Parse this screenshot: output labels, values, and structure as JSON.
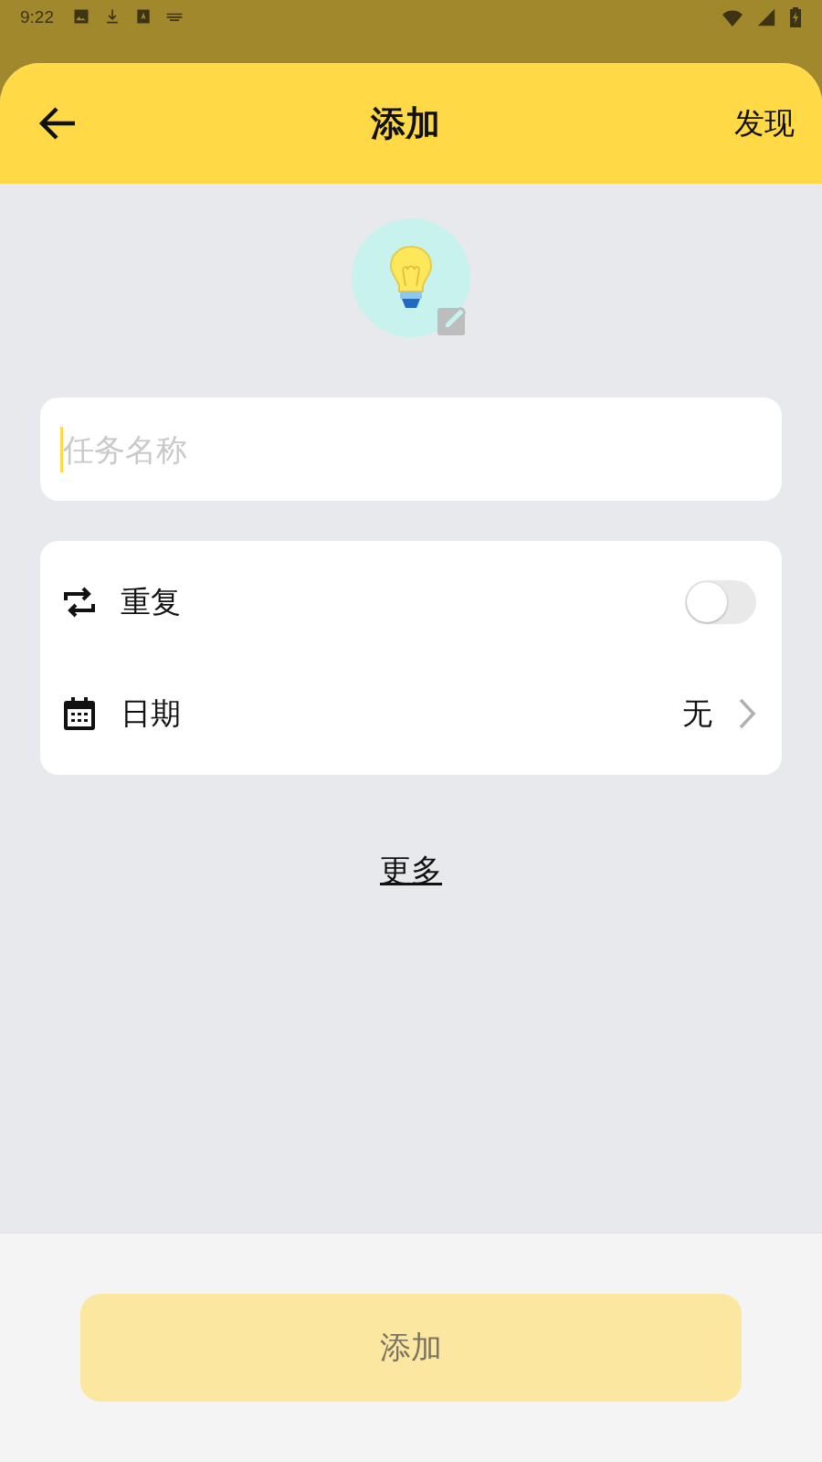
{
  "status_bar": {
    "time": "9:22"
  },
  "header": {
    "title": "添加",
    "action": "发现"
  },
  "task_name": {
    "placeholder": "任务名称"
  },
  "settings": [
    {
      "kind": "toggle",
      "label": "重复",
      "on": false
    },
    {
      "kind": "link",
      "label": "日期",
      "value": "无"
    }
  ],
  "more_link": "更多",
  "submit": {
    "label": "添加",
    "disabled": true
  }
}
